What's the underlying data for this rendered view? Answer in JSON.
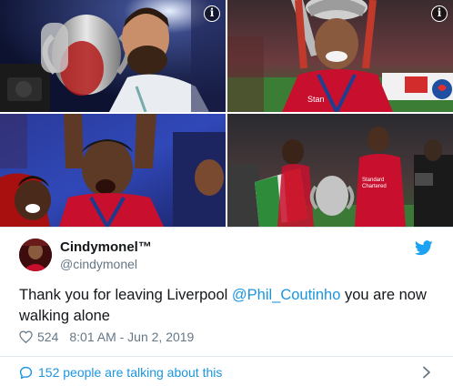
{
  "photos": [
    {
      "name": "photo-goalkeeper-with-trophy"
    },
    {
      "name": "photo-player-with-trophy-on-head"
    },
    {
      "name": "photo-players-celebrating"
    },
    {
      "name": "photo-players-with-trophy-and-flag"
    }
  ],
  "info_icon": "info-icon",
  "info_glyph": "i",
  "tweet": {
    "display_name": "Cindymonel™",
    "handle": "@cindymonel",
    "text_before": "Thank you for leaving Liverpool ",
    "mention": "@Phil_Coutinho",
    "text_after": " you are now walking alone",
    "like_count": "524",
    "timestamp": "8:01 AM - Jun 2, 2019"
  },
  "footer": {
    "label": "152 people are talking about this"
  },
  "colors": {
    "link": "#1b95e0",
    "muted": "#657786",
    "text": "#14171a",
    "twitter_blue": "#1da1f2",
    "liverpool_red": "#c8102e"
  }
}
